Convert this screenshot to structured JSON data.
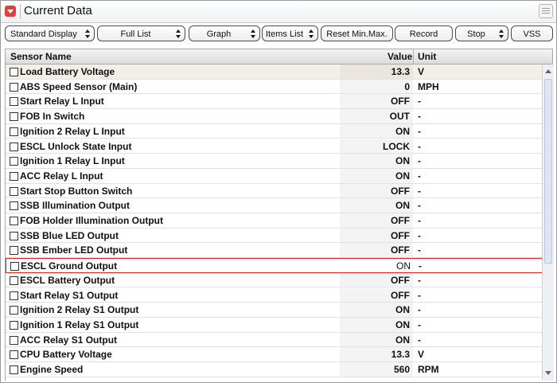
{
  "title": "Current Data",
  "toolbar": {
    "standard_display": "Standard Display",
    "full_list": "Full List",
    "graph": "Graph",
    "items_list": "Items List",
    "reset_min_max": "Reset Min.Max.",
    "record": "Record",
    "stop": "Stop",
    "vss": "VSS"
  },
  "table": {
    "col_name": "Sensor Name",
    "col_value": "Value",
    "col_unit": "Unit",
    "rows": [
      {
        "name": "Load Battery Voltage",
        "value": "13.3",
        "unit": "V"
      },
      {
        "name": "ABS Speed Sensor (Main)",
        "value": "0",
        "unit": "MPH"
      },
      {
        "name": "Start Relay L Input",
        "value": "OFF",
        "unit": "-"
      },
      {
        "name": "FOB In Switch",
        "value": "OUT",
        "unit": "-"
      },
      {
        "name": "Ignition 2 Relay L Input",
        "value": "ON",
        "unit": "-"
      },
      {
        "name": "ESCL Unlock State Input",
        "value": "LOCK",
        "unit": "-"
      },
      {
        "name": "Ignition 1 Relay L Input",
        "value": "ON",
        "unit": "-"
      },
      {
        "name": "ACC Relay L Input",
        "value": "ON",
        "unit": "-"
      },
      {
        "name": "Start Stop Button Switch",
        "value": "OFF",
        "unit": "-"
      },
      {
        "name": "SSB Illumination Output",
        "value": "ON",
        "unit": "-"
      },
      {
        "name": "FOB Holder Illumination Output",
        "value": "OFF",
        "unit": "-"
      },
      {
        "name": "SSB Blue LED Output",
        "value": "OFF",
        "unit": "-"
      },
      {
        "name": "SSB Ember LED Output",
        "value": "OFF",
        "unit": "-"
      },
      {
        "name": "ESCL Ground Output",
        "value": "ON",
        "unit": "-"
      },
      {
        "name": "ESCL Battery Output",
        "value": "OFF",
        "unit": "-"
      },
      {
        "name": "Start Relay S1 Output",
        "value": "OFF",
        "unit": "-"
      },
      {
        "name": "Ignition 2 Relay S1 Output",
        "value": "ON",
        "unit": "-"
      },
      {
        "name": "Ignition 1 Relay S1 Output",
        "value": "ON",
        "unit": "-"
      },
      {
        "name": "ACC Relay S1 Output",
        "value": "ON",
        "unit": "-"
      },
      {
        "name": "CPU Battery Voltage",
        "value": "13.3",
        "unit": "V"
      },
      {
        "name": "Engine Speed",
        "value": "560",
        "unit": "RPM"
      }
    ]
  },
  "icons": {
    "collapse": "collapse-arrow-icon",
    "menu": "menu-list-icon",
    "updown": "updown-arrows-icon",
    "checkbox": "checkbox-icon"
  },
  "colors": {
    "collapse_button": "#e0413f",
    "selection_border": "#e02020"
  }
}
